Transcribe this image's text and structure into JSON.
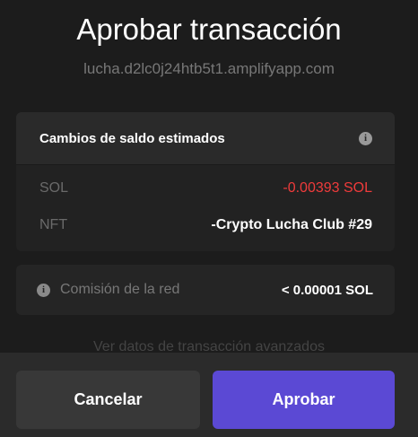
{
  "header": {
    "title": "Aprobar transacción",
    "origin": "lucha.d2lc0j24htb5t1.amplifyapp.com"
  },
  "balance_changes": {
    "title": "Cambios de saldo estimados",
    "info_icon": "info-icon",
    "rows": [
      {
        "asset": "SOL",
        "value": "-0.00393 SOL"
      },
      {
        "asset": "NFT",
        "value": "-Crypto Lucha Club #29"
      }
    ],
    "negative_color": "#ef3b3b"
  },
  "network_fee": {
    "label": "Comisión de la red",
    "value": "< 0.00001 SOL"
  },
  "advanced_link": "Ver datos de transacción avanzados",
  "actions": {
    "cancel_label": "Cancelar",
    "approve_label": "Aprobar",
    "approve_color": "#5b49d4"
  }
}
